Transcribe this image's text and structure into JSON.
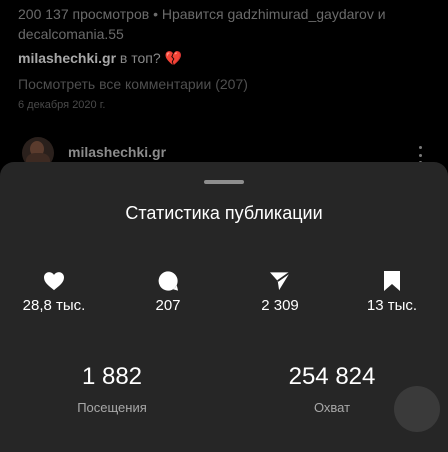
{
  "background_post": {
    "views_line": "200 137 просмотров • Нравится gadzhimurad_gaydarov и decalcomania.55",
    "caption_user": "milashechki.gr",
    "caption_text": " в топ? ",
    "caption_emoji": "💔",
    "view_all_comments": "Посмотреть все комментарии (207)",
    "date": "6 декабря 2020 г.",
    "next_post_username": "milashechki.gr"
  },
  "sheet": {
    "title": "Статистика публикации",
    "stats": [
      {
        "icon": "heart-icon",
        "value": "28,8 тыс."
      },
      {
        "icon": "comment-icon",
        "value": "207"
      },
      {
        "icon": "send-icon",
        "value": "2 309"
      },
      {
        "icon": "bookmark-icon",
        "value": "13 тыс."
      }
    ],
    "visits": {
      "value": "1 882",
      "label": "Посещения"
    },
    "reach": {
      "value": "254 824",
      "label": "Охват"
    }
  },
  "colors": {
    "sheet_background": "#262626",
    "fab_accent": "#f5c400",
    "broken_heart": "#b3232f"
  }
}
